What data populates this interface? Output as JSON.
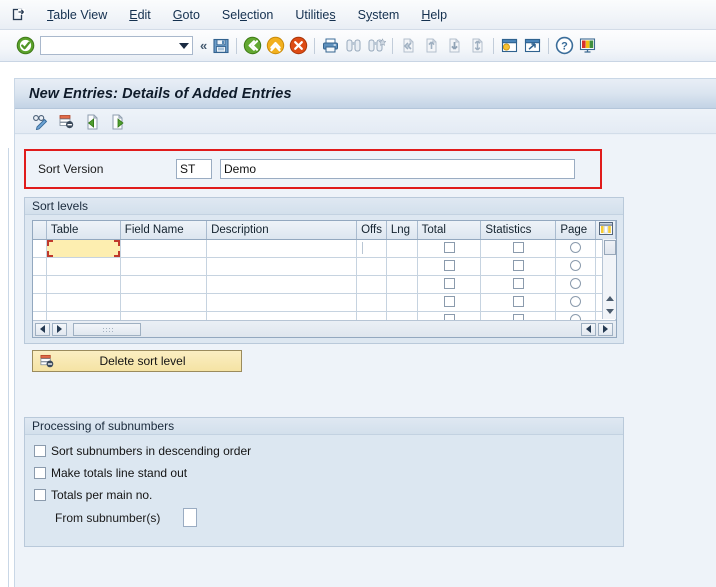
{
  "menubar": {
    "system_icon": "exit-window-icon",
    "items": [
      {
        "label": "Table View",
        "accel_index": 0
      },
      {
        "label": "Edit",
        "accel_index": 0
      },
      {
        "label": "Goto",
        "accel_index": 0
      },
      {
        "label": "Selection",
        "accel_index": 2
      },
      {
        "label": "Utilities",
        "accel_index": 8
      },
      {
        "label": "System",
        "accel_index": 1
      },
      {
        "label": "Help",
        "accel_index": 0
      }
    ]
  },
  "toolbar": {
    "ok_icon": "enter-check-icon",
    "command_field": {
      "value": "",
      "placeholder": ""
    },
    "dropdown_icon": "chevron-down-icon",
    "collapse_icon": "double-chevron-left-icon",
    "buttons": [
      {
        "name": "save-button",
        "icon": "floppy-disk-icon",
        "title": "Save"
      },
      {
        "name": "back-button",
        "icon": "green-back-arrow-icon",
        "title": "Back"
      },
      {
        "name": "exit-button",
        "icon": "yellow-up-arrow-icon",
        "title": "Exit"
      },
      {
        "name": "cancel-button",
        "icon": "red-x-circle-icon",
        "title": "Cancel"
      },
      {
        "name": "print-button",
        "icon": "printer-icon",
        "title": "Print"
      },
      {
        "name": "find-button",
        "icon": "binoculars-icon",
        "title": "Find"
      },
      {
        "name": "find-next-button",
        "icon": "binoculars-plus-icon",
        "title": "Find Next"
      },
      {
        "name": "first-page-button",
        "icon": "first-page-icon",
        "title": "First Page"
      },
      {
        "name": "previous-page-button",
        "icon": "previous-page-icon",
        "title": "Previous Page"
      },
      {
        "name": "next-page-button",
        "icon": "next-page-icon",
        "title": "Next Page"
      },
      {
        "name": "last-page-button",
        "icon": "last-page-icon",
        "title": "Last Page"
      },
      {
        "name": "create-session-button",
        "icon": "new-session-icon",
        "title": "Create New Session"
      },
      {
        "name": "create-shortcut-button",
        "icon": "shortcut-window-icon",
        "title": "Create Shortcut"
      },
      {
        "name": "help-button",
        "icon": "question-help-icon",
        "title": "Help"
      },
      {
        "name": "customize-button",
        "icon": "layout-customize-icon",
        "title": "Customizing of Local Layout"
      }
    ]
  },
  "window": {
    "title": "New Entries: Details of Added Entries",
    "app_toolbar": [
      {
        "name": "display-change-button",
        "icon": "glasses-pencil-icon"
      },
      {
        "name": "delete-entry-button",
        "icon": "delete-row-icon"
      },
      {
        "name": "previous-entry-button",
        "icon": "page-green-left-icon"
      },
      {
        "name": "next-entry-button",
        "icon": "page-green-right-icon"
      }
    ]
  },
  "sort_version": {
    "label": "Sort Version",
    "key": {
      "value": "ST",
      "placeholder": ""
    },
    "description": {
      "value": "Demo",
      "placeholder": ""
    },
    "highlight_color": "#e01b1b"
  },
  "sort_levels": {
    "group_title": "Sort levels",
    "column_config_icon": "column-settings-icon",
    "columns": [
      "Table",
      "Field Name",
      "Description",
      "Offs",
      "Lng",
      "Total",
      "Statistics",
      "Page"
    ],
    "rows": [
      {
        "table": "",
        "field_name": "",
        "description": "",
        "offs": "",
        "lng": "",
        "total": false,
        "statistics": false,
        "page": false,
        "focused": true
      },
      {
        "table": "",
        "field_name": "",
        "description": "",
        "offs": "",
        "lng": "",
        "total": false,
        "statistics": false,
        "page": false,
        "focused": false
      },
      {
        "table": "",
        "field_name": "",
        "description": "",
        "offs": "",
        "lng": "",
        "total": false,
        "statistics": false,
        "page": false,
        "focused": false
      },
      {
        "table": "",
        "field_name": "",
        "description": "",
        "offs": "",
        "lng": "",
        "total": false,
        "statistics": false,
        "page": false,
        "focused": false
      },
      {
        "table": "",
        "field_name": "",
        "description": "",
        "offs": "",
        "lng": "",
        "total": false,
        "statistics": false,
        "page": false,
        "focused": false
      }
    ],
    "matchcode_icon": "value-help-icon",
    "scroll_left_icon": "arrow-left-icon",
    "scroll_right_icon": "arrow-right-icon",
    "scroll_up_icon": "arrow-up-icon",
    "scroll_down_icon": "arrow-down-icon",
    "delete_button": {
      "label": "Delete sort level",
      "icon": "delete-row-icon"
    }
  },
  "subnumbers": {
    "group_title": "Processing of subnumbers",
    "checkboxes": [
      {
        "label": "Sort subnumbers in descending order",
        "checked": false
      },
      {
        "label": "Make totals line stand out",
        "checked": false
      },
      {
        "label": "Totals per main no.",
        "checked": false
      }
    ],
    "from_subnumbers": {
      "label": "From subnumber(s)",
      "value": "",
      "placeholder": ""
    }
  }
}
